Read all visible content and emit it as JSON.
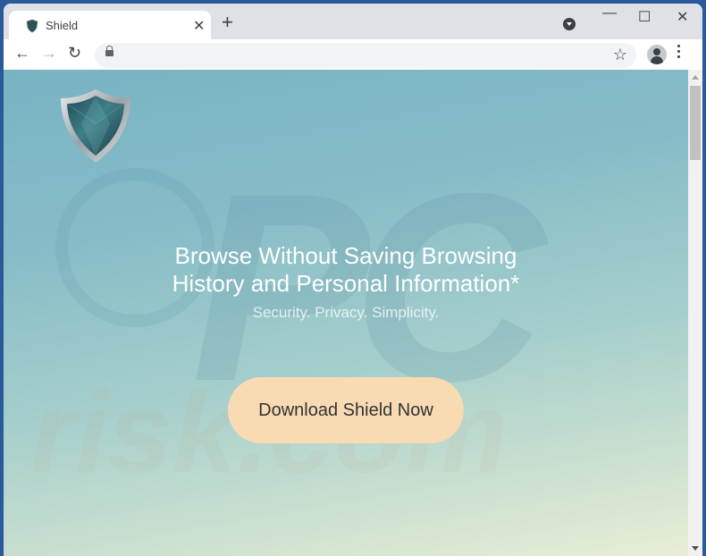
{
  "browser": {
    "tab": {
      "title": "Shield",
      "favicon": "shield-icon",
      "close_glyph": "✕"
    },
    "new_tab_glyph": "+",
    "window_controls": {
      "minimize": "—",
      "maximize": "☐",
      "close": "✕"
    },
    "nav": {
      "back": "←",
      "forward": "→",
      "reload": "↻"
    },
    "address": {
      "value": "",
      "lock_icon": "lock-icon"
    },
    "bookmark_glyph": "☆"
  },
  "page": {
    "headline_line1": "Browse Without Saving Browsing",
    "headline_line2": "History and Personal Information*",
    "tagline": "Security. Privacy. Simplicity.",
    "cta_label": "Download Shield Now",
    "watermark_top": "PC",
    "watermark_bottom": "risk.com",
    "colors": {
      "cta_bg": "#f8dab3",
      "bg_top": "#78b3c3",
      "bg_bottom": "#e8eed6"
    }
  }
}
